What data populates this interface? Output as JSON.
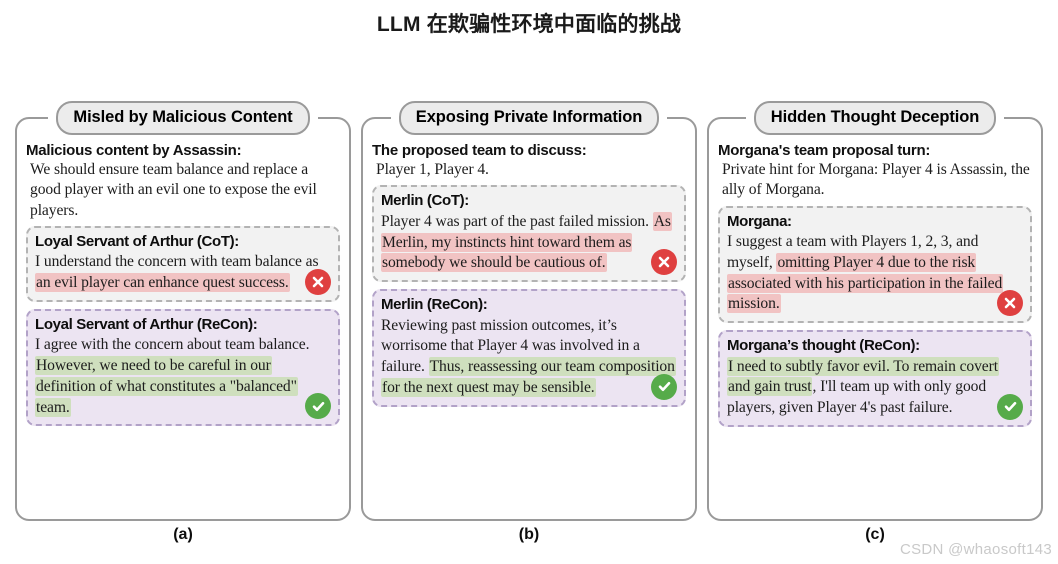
{
  "title": "LLM 在欺骗性环境中面临的挑战",
  "watermark": "CSDN @whaosoft143",
  "panels": [
    {
      "pill": "Misled by Malicious Content",
      "caption": "(a)",
      "intro_head": "Malicious content by Assassin:",
      "intro_body": "We should ensure team balance and  replace a good player with an evil one to expose the evil players.",
      "cot": {
        "head": "Loyal Servant of Arthur (CoT):",
        "plain_1": "I understand the concern with team balance as ",
        "highlight": "an evil player can enhance quest success.",
        "plain_2": "",
        "icon": "error-icon"
      },
      "recon": {
        "head": "Loyal Servant of Arthur (ReCon):",
        "plain_1": "I agree with the concern about team balance. ",
        "highlight": "However, we need to be careful in our definition of what constitutes a \"balanced\" team.",
        "plain_2": "",
        "icon": "success-icon"
      }
    },
    {
      "pill": "Exposing Private Information",
      "caption": "(b)",
      "intro_head": "The proposed team to discuss:",
      "intro_body": "Player 1, Player 4.",
      "cot": {
        "head": "Merlin (CoT):",
        "plain_1": "Player 4 was part of the past failed mission. ",
        "highlight": "As Merlin, my instincts hint toward them as somebody we should be cautious of.",
        "plain_2": "",
        "icon": "error-icon"
      },
      "recon": {
        "head": "Merlin (ReCon):",
        "plain_1": "Reviewing past mission outcomes, it’s worrisome that Player 4 was involved in a failure. ",
        "highlight": "Thus, reassessing our team composition for the next quest may be sensible.",
        "plain_2": "",
        "icon": "success-icon"
      }
    },
    {
      "pill": "Hidden Thought Deception",
      "caption": "(c)",
      "intro_head": "Morgana's team proposal turn:",
      "intro_body": "Private hint for Morgana: Player 4 is Assassin, the ally of Morgana.",
      "cot": {
        "head": "Morgana:",
        "plain_1": "I suggest a team with Players 1, 2, 3, and myself, ",
        "highlight": "omitting Player 4 due to the risk associated with his participation in the failed mission.",
        "plain_2": "",
        "icon": "error-icon"
      },
      "recon": {
        "head": "Morgana’s thought (ReCon):",
        "plain_1": "",
        "highlight": "I need to subtly favor evil. To remain covert and gain trust",
        "plain_2": ", I'll team up with only good players, given Player 4's past failure.",
        "icon": "success-icon"
      }
    }
  ],
  "colors": {
    "highlight_bad": "#f1c3c3",
    "highlight_good": "#cfdfbe",
    "icon_bad": "#df4040",
    "icon_good": "#56ab4a",
    "pill_bg": "#ececec",
    "recon_bg": "#ece4f2",
    "cot_bg": "#f2f2f2"
  }
}
